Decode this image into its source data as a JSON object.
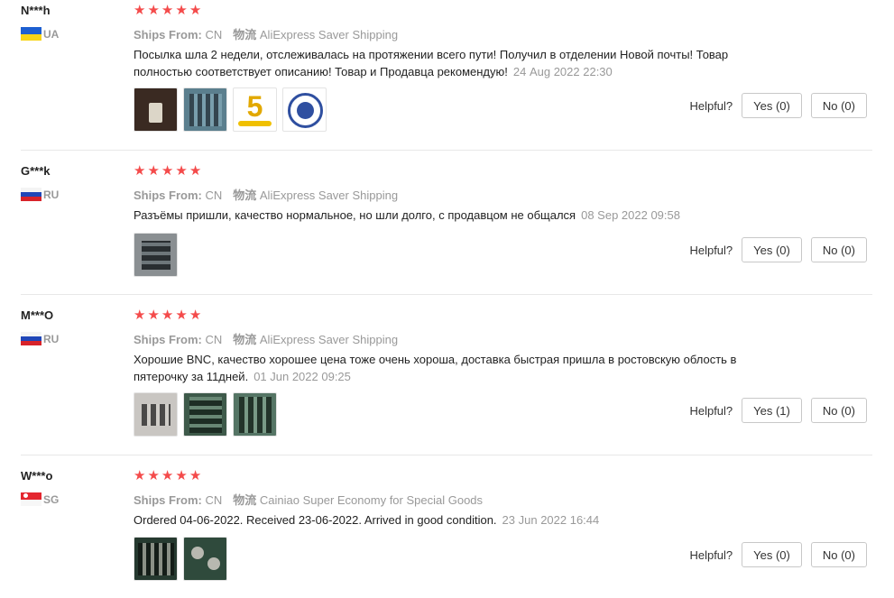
{
  "reviews": [
    {
      "user": "N***h",
      "country": "UA",
      "stars": 5,
      "ships_from_label": "Ships From:",
      "ships_from": "CN",
      "logistics_label": "物流",
      "logistics": "AliExpress Saver Shipping",
      "text": "Посылка шла 2 недели, отслеживалась на протяжении всего пути! Получил в отделении Новой почты! Товар полностью соответствует описанию! Товар и Продавца рекомендую!",
      "date": "24 Aug 2022 22:30",
      "helpful_label": "Helpful?",
      "yes": "Yes (0)",
      "no": "No (0)",
      "five_text": "5"
    },
    {
      "user": "G***k",
      "country": "RU",
      "stars": 5,
      "ships_from_label": "Ships From:",
      "ships_from": "CN",
      "logistics_label": "物流",
      "logistics": "AliExpress Saver Shipping",
      "text": "Разъёмы пришли, качество нормальное, но шли долго, с продавцом не общался",
      "date": "08 Sep 2022 09:58",
      "helpful_label": "Helpful?",
      "yes": "Yes (0)",
      "no": "No (0)"
    },
    {
      "user": "M***O",
      "country": "RU",
      "stars": 5,
      "ships_from_label": "Ships From:",
      "ships_from": "CN",
      "logistics_label": "物流",
      "logistics": "AliExpress Saver Shipping",
      "text": "Хорошие BNC, качество хорошее цена тоже очень хороша, доставка быстрая пришла в ростовскую облость в пятерочку за 11дней.",
      "date": "01 Jun 2022 09:25",
      "helpful_label": "Helpful?",
      "yes": "Yes (1)",
      "no": "No (0)"
    },
    {
      "user": "W***o",
      "country": "SG",
      "stars": 5,
      "ships_from_label": "Ships From:",
      "ships_from": "CN",
      "logistics_label": "物流",
      "logistics": "Cainiao Super Economy for Special Goods",
      "text": "Ordered 04-06-2022. Received 23-06-2022. Arrived in good condition.",
      "date": "23 Jun 2022 16:44",
      "helpful_label": "Helpful?",
      "yes": "Yes (0)",
      "no": "No (0)"
    }
  ],
  "colors": {
    "star": "#f44b4b",
    "muted": "#999999",
    "divider": "#e8e8e8"
  },
  "icons": {
    "star": "star-icon"
  }
}
